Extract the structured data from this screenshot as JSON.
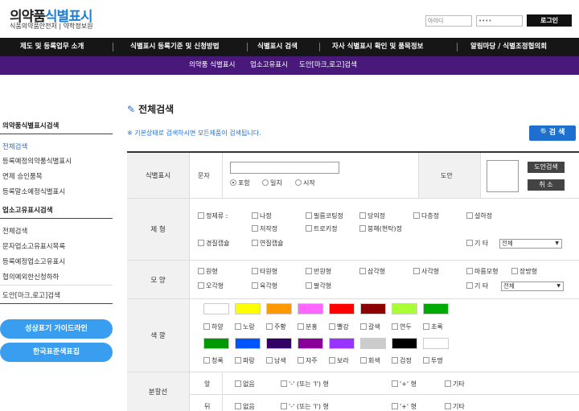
{
  "header": {
    "logo_dark": "의약품",
    "logo_blue": "식별표시",
    "org1": "식품의약품안전처",
    "org2": "약학정보원",
    "id_placeholder": "아이디",
    "pw_placeholder": "••••",
    "login_label": "로그인"
  },
  "gnb": [
    "제도 및 등록업무 소개",
    "식별표시 등록기준 및 신청방법",
    "식별표시 검색",
    "자사 식별표시 확인 및 품목정보",
    "알림마당 / 식별조정협의회"
  ],
  "subnav": [
    "의약품 식별표시",
    "업소고유표시",
    "도안[마크,로고]검색"
  ],
  "sidebar": {
    "sec1_title": "의약품식별표시검색",
    "sec1_items": [
      "전체검색",
      "등록예정의약품식별표시",
      "면제 승인품목",
      "등록말소예정식별표시"
    ],
    "sec2_title": "업소고유표시검색",
    "sec2_items": [
      "전체검색",
      "문자업소고유표시목록",
      "등록예정업소고유표시",
      "협의예외한신청하하"
    ],
    "sec3_title": "도안[마크,로고]검색",
    "guide_btn": "성상표기 가이드라인",
    "color_btn": "한국표준색표집"
  },
  "main": {
    "title": "전체검색",
    "note": "※ 기본상태로 검색하시면 모든제품이 검색됩니다.",
    "search_btn": "검 색",
    "row1": {
      "label": "식별표시",
      "text_label": "문자",
      "radios": [
        "포함",
        "일치",
        "시작"
      ],
      "design_label": "도안",
      "design_search_btn": "도안검색",
      "cancel_btn": "취 소"
    },
    "row2": {
      "label": "제 형",
      "items": [
        "정제류 :",
        "나정",
        "필름코팅정",
        "당의정",
        "다층정",
        "설하정",
        "저작정",
        "트로키정",
        "붕해(현탁)정",
        "경질캡슐",
        "연질캡슐"
      ],
      "other": "기 타",
      "select": "전체"
    },
    "row3": {
      "label": "모 양",
      "items": [
        "원형",
        "타원형",
        "반원형",
        "삼각형",
        "사각형",
        "마름모형",
        "장방형",
        "오각형",
        "육각형",
        "팔각형"
      ],
      "other": "기 타",
      "select": "전체"
    },
    "row4": {
      "label": "색 깔",
      "colors1": [
        "하양",
        "노랑",
        "주황",
        "분홍",
        "빨강",
        "갈색",
        "연두",
        "초록"
      ],
      "colors2": [
        "청록",
        "파랑",
        "남색",
        "자주",
        "보라",
        "회색",
        "검정",
        "투명"
      ],
      "swatches1": [
        "#ffffff",
        "#ffff00",
        "#ff9900",
        "#ff66ff",
        "#ff0000",
        "#8b0000",
        "#aaff33",
        "#00aa00"
      ],
      "swatches2": [
        "#009900",
        "#0055ff",
        "#330066",
        "#880099",
        "#9933ff",
        "#cccccc",
        "#000000",
        "#ffffff"
      ]
    },
    "row5": {
      "label": "분할선",
      "front": "앞",
      "back": "뒤",
      "items": [
        "없음",
        "'-' (또는 'l') 형",
        "'+' 형",
        "기타"
      ]
    }
  },
  "colors": {
    "accent": "#1f6fd0",
    "gnb": "#161616",
    "subnav": "#48197a",
    "guide_btn": "#3a9ef0"
  }
}
